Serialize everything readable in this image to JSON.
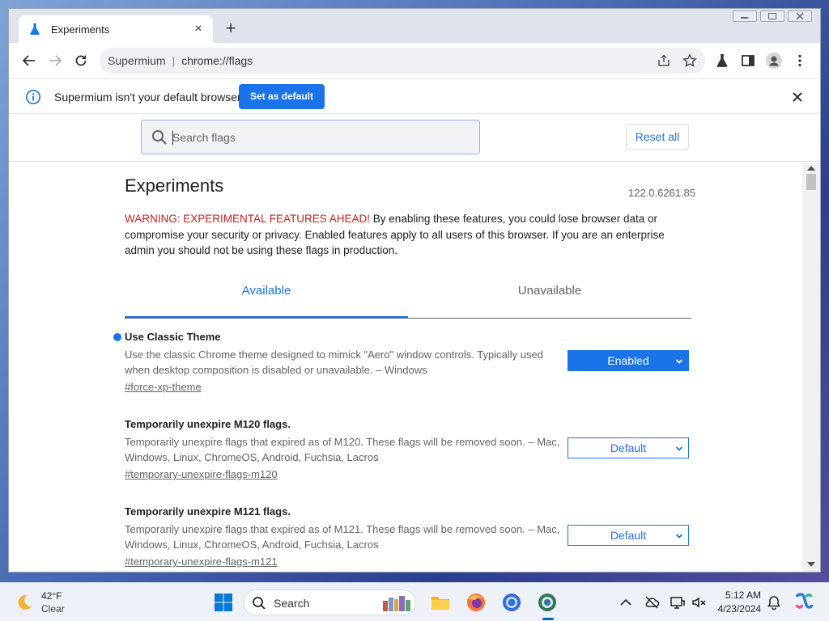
{
  "browser": {
    "tab_title": "Experiments",
    "tab_close": "×",
    "new_tab": "+",
    "omnibox_site": "Supermium",
    "omnibox_separator": "|",
    "omnibox_url": "chrome://flags"
  },
  "infobar": {
    "message": "Supermium isn't your default browser",
    "button": "Set as default"
  },
  "flags_page": {
    "search_placeholder": "Search flags",
    "reset_all": "Reset all",
    "title": "Experiments",
    "version": "122.0.6261.85",
    "warning_prefix": "WARNING: EXPERIMENTAL FEATURES AHEAD!",
    "warning_body": " By enabling these features, you could lose browser data or compromise your security or privacy. Enabled features apply to all users of this browser. If you are an enterprise admin you should not be using these flags in production.",
    "tabs": [
      {
        "label": "Available",
        "active": true
      },
      {
        "label": "Unavailable",
        "active": false
      }
    ],
    "flags": [
      {
        "name": "Use Classic Theme",
        "description": "Use the classic Chrome theme designed to mimick \"Aero\" window controls. Typically used when desktop composition is disabled or unavailable. – Windows",
        "link": "#force-xp-theme",
        "state": "Enabled",
        "modified": true
      },
      {
        "name": "Temporarily unexpire M120 flags.",
        "description": "Temporarily unexpire flags that expired as of M120. These flags will be removed soon. – Mac, Windows, Linux, ChromeOS, Android, Fuchsia, Lacros",
        "link": "#temporary-unexpire-flags-m120",
        "state": "Default",
        "modified": false
      },
      {
        "name": "Temporarily unexpire M121 flags.",
        "description": "Temporarily unexpire flags that expired as of M121. These flags will be removed soon. – Mac, Windows, Linux, ChromeOS, Android, Fuchsia, Lacros",
        "link": "#temporary-unexpire-flags-m121",
        "state": "Default",
        "modified": false
      }
    ]
  },
  "taskbar": {
    "weather_temp": "42°F",
    "weather_condition": "Clear",
    "search_label": "Search",
    "time": "5:12 AM",
    "date": "4/23/2024"
  },
  "colors": {
    "accent": "#1a73e8",
    "warning_red": "#c5221f"
  }
}
